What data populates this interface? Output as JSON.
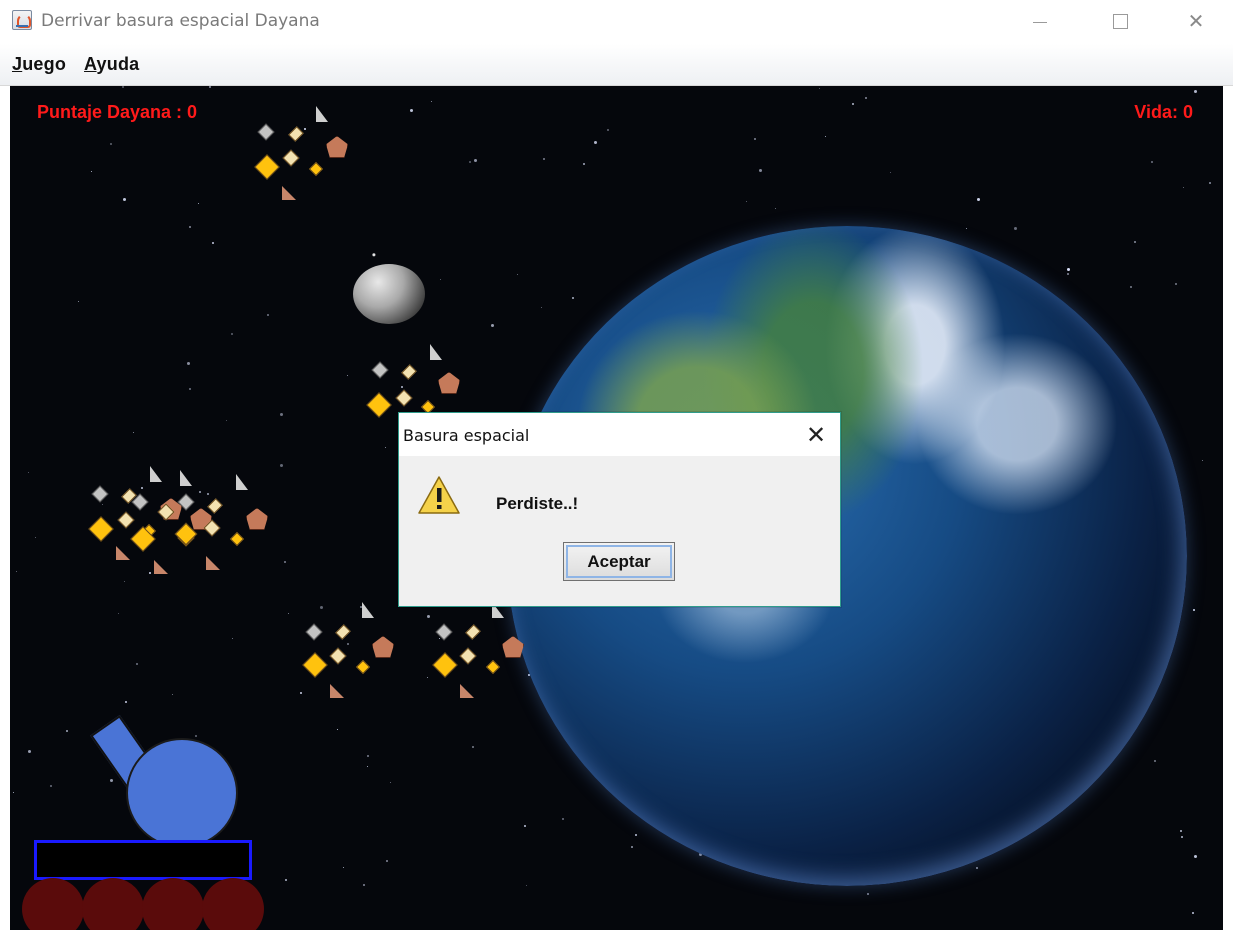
{
  "window": {
    "title": "Derrivar basura espacial Dayana"
  },
  "menubar": {
    "items": [
      {
        "mnemonic": "J",
        "rest": "uego"
      },
      {
        "mnemonic": "A",
        "rest": "yuda"
      }
    ]
  },
  "hud": {
    "score": "Puntaje Dayana : 0",
    "life": "Vida: 0"
  },
  "dialog": {
    "title": "Basura espacial",
    "message": "Perdiste..!",
    "button": "Aceptar",
    "icon": "warning-icon"
  },
  "colors": {
    "hud_text": "#ff1a1a",
    "cannon": "#4a74d6",
    "cannon_base_border": "#1a1aff",
    "wheels": "#5a0b0b",
    "debris_gold": "#ffc20e",
    "debris_cream": "#f3e2b1",
    "debris_grey": "#c3c3c3",
    "debris_brown": "#c57a5a"
  }
}
